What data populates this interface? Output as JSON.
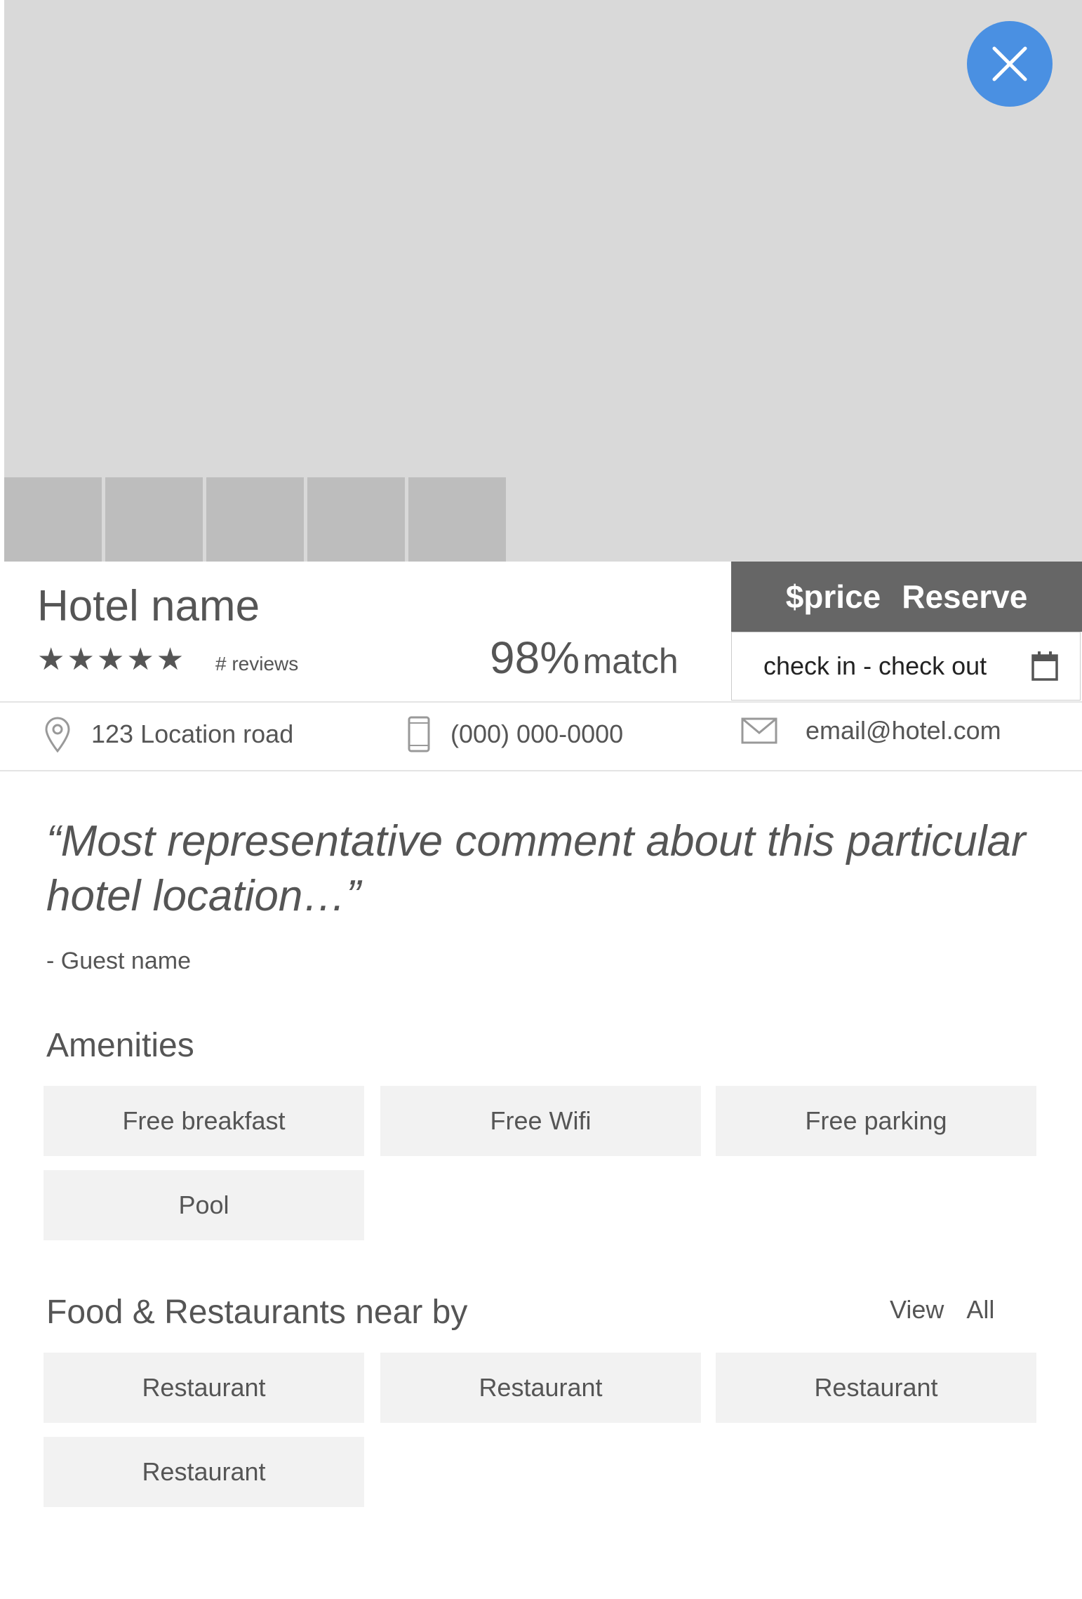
{
  "hotel": {
    "name": "Hotel name",
    "stars": "★★★★★",
    "reviews_label": "# reviews",
    "match_percent": "98%",
    "match_label": "match",
    "rating": 5
  },
  "booking": {
    "price_label": "$price",
    "reserve_label": "Reserve",
    "dates_label": "check in - check out"
  },
  "contact": {
    "address": "123 Location road",
    "phone": "(000) 000-0000",
    "email": "email@hotel.com"
  },
  "review": {
    "quote": "“Most representative comment about this particular hotel location…”",
    "guest": "- Guest name"
  },
  "amenities": {
    "title": "Amenities",
    "items": [
      "Free breakfast",
      "Free Wifi",
      "Free parking",
      "Pool"
    ]
  },
  "food": {
    "title": "Food & Restaurants near by",
    "view_label": "View",
    "all_label": "All",
    "items": [
      "Restaurant",
      "Restaurant",
      "Restaurant",
      "Restaurant"
    ]
  },
  "colors": {
    "accent": "#4a90e2",
    "reserve_bg": "#666666",
    "image_placeholder": "#d9d9d9",
    "thumb_placeholder": "#bdbdbd",
    "chip_bg": "#f2f2f2"
  },
  "icons": {
    "close": "close-icon",
    "location": "location-pin-icon",
    "phone": "phone-icon",
    "email": "envelope-icon",
    "calendar": "calendar-icon"
  }
}
